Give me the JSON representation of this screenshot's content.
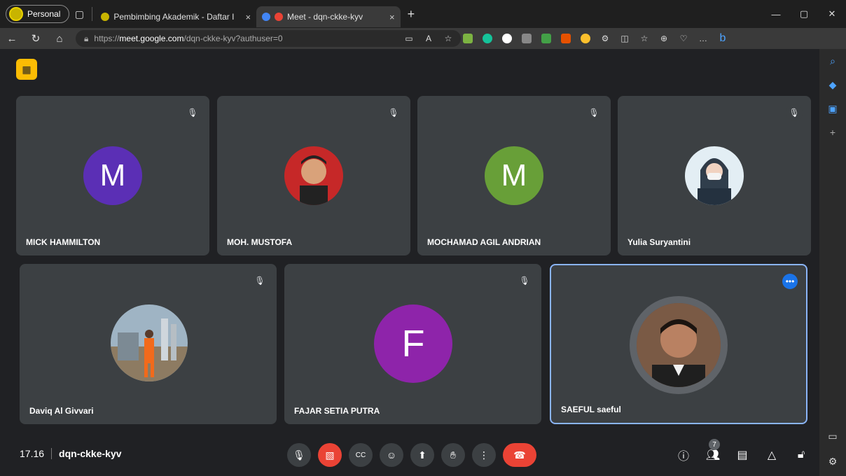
{
  "browser": {
    "profile_label": "Personal",
    "tabs": [
      {
        "title": "Pembimbing Akademik - Daftar I",
        "favicon_color": "#c8b400"
      },
      {
        "title": "Meet - dqn-ckke-kyv",
        "favicon_color": "#ea4335"
      }
    ],
    "close_glyph": "×",
    "url_prefix": "https://",
    "url_host": "meet.google.com",
    "url_path": "/dqn-ckke-kyv?authuser=0"
  },
  "meet": {
    "participants": [
      {
        "name": "MICK HAMMILTON",
        "initial": "M",
        "color": "#5b2fb5"
      },
      {
        "name": "MOH. MUSTOFA",
        "color": "#c62828"
      },
      {
        "name": "MOCHAMAD AGIL ANDRIAN",
        "initial": "M",
        "color": "#689f38"
      },
      {
        "name": "Yulia Suryantini",
        "color": "#e3eef4"
      },
      {
        "name": "Daviq Al Givvari",
        "color": "#9fb4c4"
      },
      {
        "name": "FAJAR SETIA PUTRA",
        "initial": "F",
        "color": "#8e24aa"
      },
      {
        "name": "SAEFUL saeful",
        "color": "#6d4c3b"
      }
    ],
    "time": "17.16",
    "meeting_code": "dqn-ckke-kyv",
    "participant_count": "7",
    "accent_colors": {
      "end_call": "#ea4335",
      "active_speaker": "#8ab4f8",
      "record_badge": "#fbbc04"
    }
  }
}
